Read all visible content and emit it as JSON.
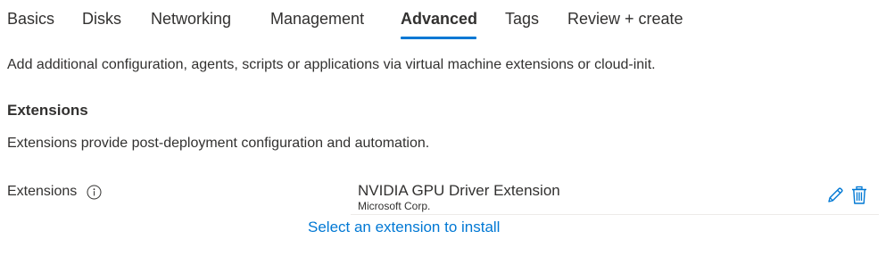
{
  "tabs": [
    {
      "label": "Basics",
      "active": false
    },
    {
      "label": "Disks",
      "active": false
    },
    {
      "label": "Networking",
      "active": false
    },
    {
      "label": "Management",
      "active": false
    },
    {
      "label": "Advanced",
      "active": true
    },
    {
      "label": "Tags",
      "active": false
    },
    {
      "label": "Review + create",
      "active": false
    }
  ],
  "page": {
    "description": "Add additional configuration, agents, scripts or applications via virtual machine extensions or cloud-init."
  },
  "extensions_section": {
    "title": "Extensions",
    "description": "Extensions provide post-deployment configuration and automation.",
    "field_label": "Extensions",
    "info_icon": "info-icon",
    "items": [
      {
        "name": "NVIDIA GPU Driver Extension",
        "publisher": "Microsoft Corp.",
        "edit_icon": "pencil-icon",
        "delete_icon": "trash-icon"
      }
    ],
    "install_link": "Select an extension to install"
  },
  "colors": {
    "accent": "#0078d4",
    "text": "#323130",
    "divider": "#edebe9"
  }
}
